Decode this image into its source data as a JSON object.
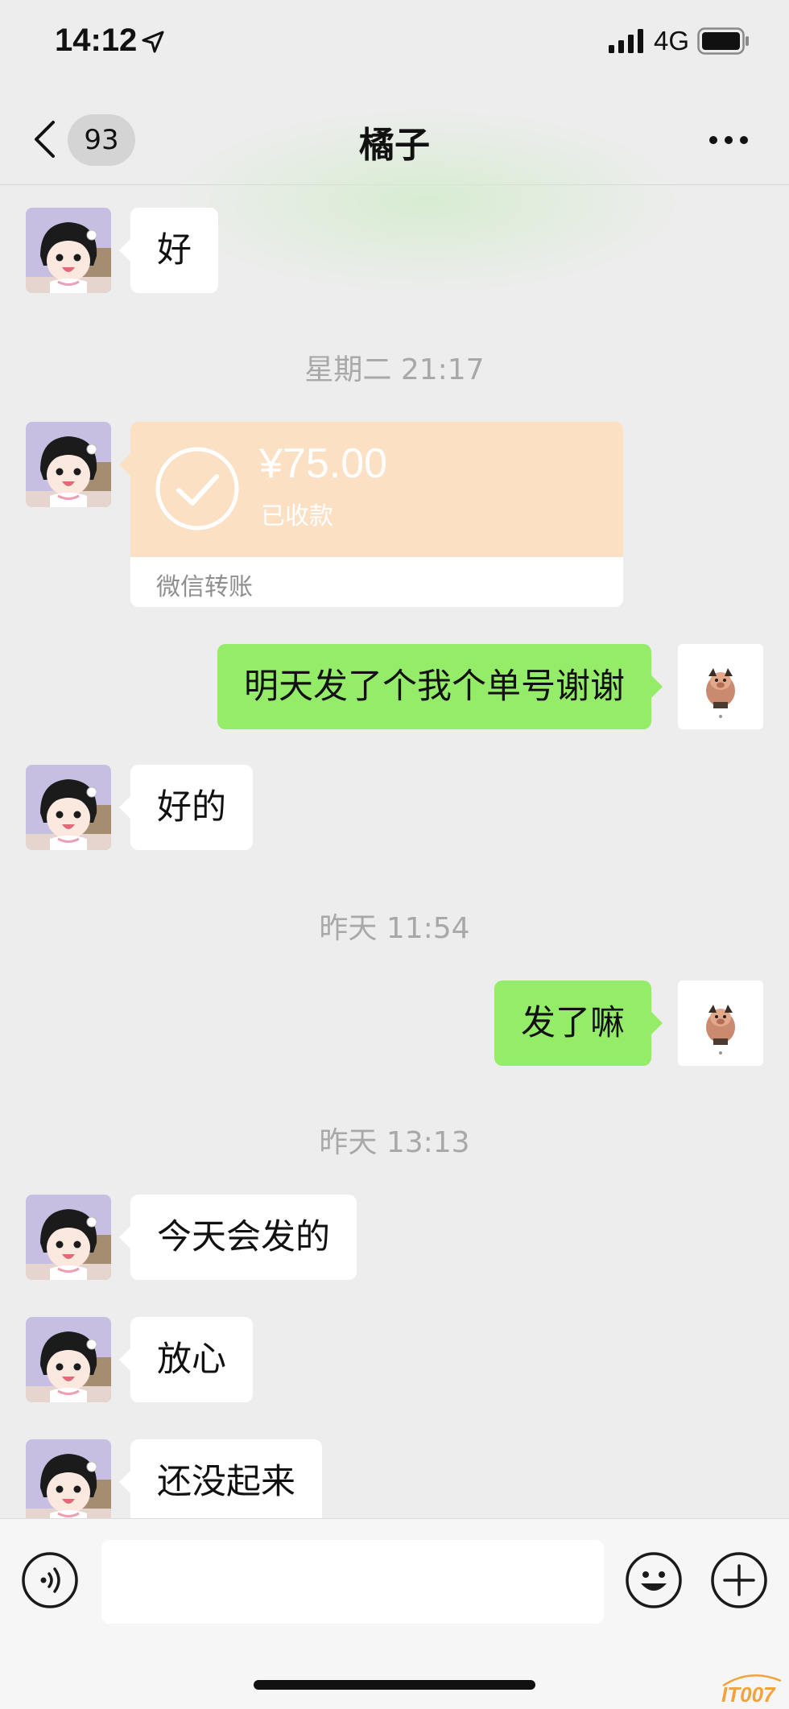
{
  "status_bar": {
    "time": "14:12",
    "network": "4G",
    "icons": [
      "location-arrow-icon",
      "signal-bars-icon",
      "battery-icon"
    ]
  },
  "nav": {
    "back_icon": "chevron-left-icon",
    "unread_count": "93",
    "title": "橘子",
    "more_icon": "more-dots-icon"
  },
  "messages": [
    {
      "side": "left",
      "text": "好"
    },
    {
      "timestamp": "星期二 21:17"
    },
    {
      "side": "left",
      "type": "transfer",
      "amount": "¥75.00",
      "status": "已收款",
      "label": "微信转账"
    },
    {
      "side": "right",
      "text": "明天发了个我个单号谢谢"
    },
    {
      "side": "left",
      "text": "好的"
    },
    {
      "timestamp": "昨天 11:54"
    },
    {
      "side": "right",
      "text": "发了嘛"
    },
    {
      "timestamp": "昨天 13:13"
    },
    {
      "side": "left",
      "text": "今天会发的"
    },
    {
      "side": "left",
      "text": "放心"
    },
    {
      "side": "left",
      "text": "还没起来"
    }
  ],
  "input_bar": {
    "voice_icon": "voice-icon",
    "emoji_icon": "emoji-icon",
    "plus_icon": "plus-icon",
    "input_value": ""
  },
  "watermark": "IT007",
  "colors": {
    "background": "#ededed",
    "self_bubble": "#95ec69",
    "other_bubble": "#ffffff",
    "transfer_card": "#fbe0c4",
    "timestamp_text": "#a8a8a8"
  }
}
